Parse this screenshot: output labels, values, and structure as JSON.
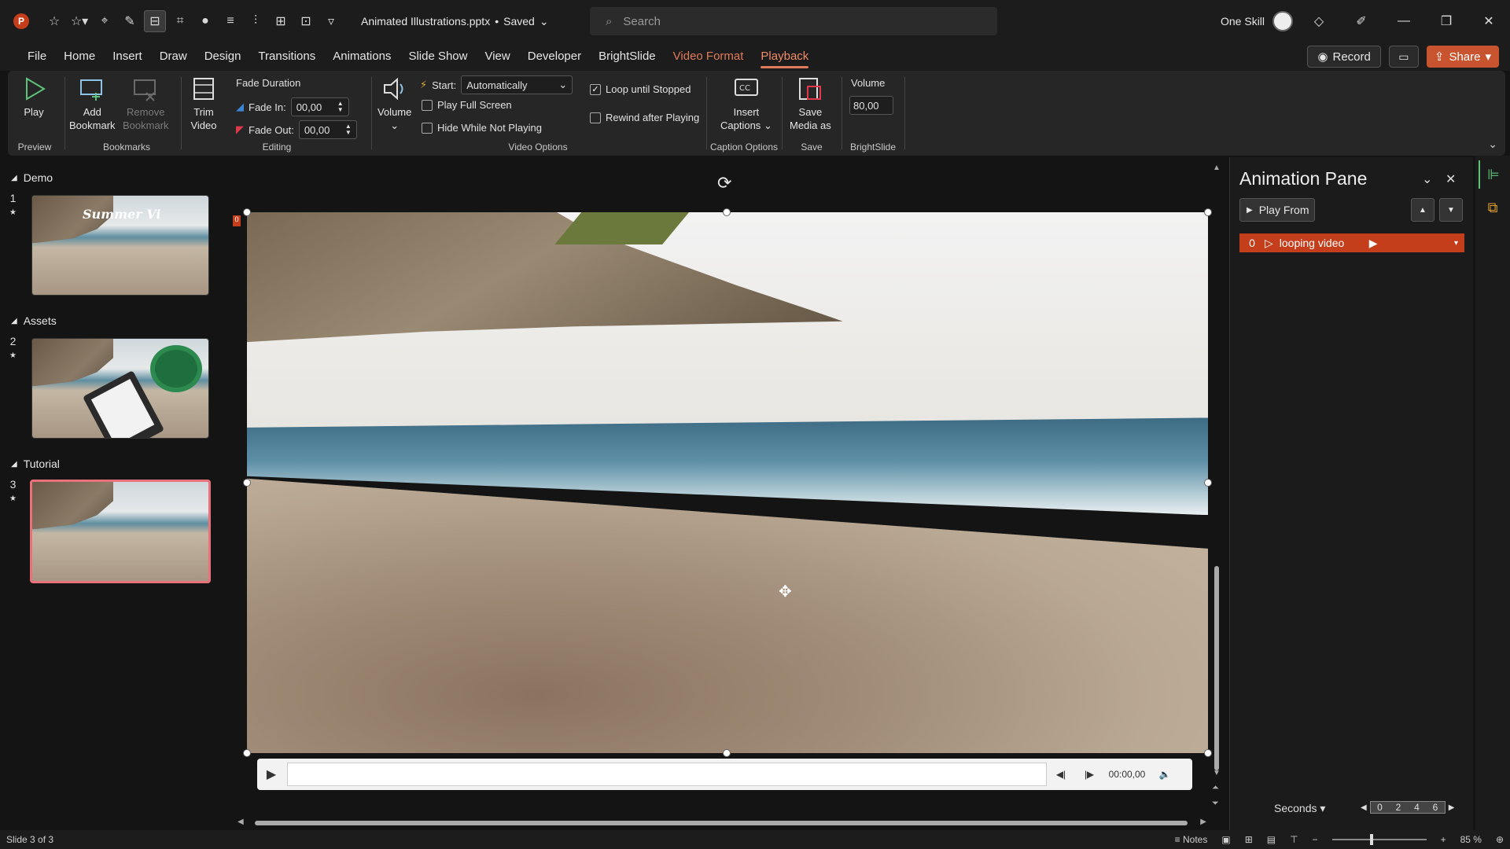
{
  "app": {
    "logo_letter": "P",
    "doc_title": "Animated Illustrations.pptx",
    "save_status": "Saved",
    "search_placeholder": "Search",
    "user_name": "One Skill"
  },
  "tabs": [
    "File",
    "Home",
    "Insert",
    "Draw",
    "Design",
    "Transitions",
    "Animations",
    "Slide Show",
    "View",
    "Developer",
    "BrightSlide",
    "Video Format",
    "Playback"
  ],
  "tab_actions": {
    "record": "Record",
    "share": "Share"
  },
  "ribbon": {
    "preview": {
      "play": "Play",
      "group": "Preview"
    },
    "bookmarks": {
      "add_line1": "Add",
      "add_line2": "Bookmark",
      "remove_line1": "Remove",
      "remove_line2": "Bookmark",
      "group": "Bookmarks"
    },
    "editing": {
      "trim_line1": "Trim",
      "trim_line2": "Video",
      "fade_duration": "Fade Duration",
      "fade_in_label": "Fade In:",
      "fade_in_value": "00,00",
      "fade_out_label": "Fade Out:",
      "fade_out_value": "00,00",
      "group": "Editing"
    },
    "video_options": {
      "volume": "Volume",
      "start_label": "Start:",
      "start_value": "Automatically",
      "play_full_screen": "Play Full Screen",
      "hide_while_not_playing": "Hide While Not Playing",
      "loop_until_stopped": "Loop until Stopped",
      "rewind_after_playing": "Rewind after Playing",
      "group": "Video Options"
    },
    "captions": {
      "insert_line1": "Insert",
      "insert_line2": "Captions",
      "group": "Caption Options"
    },
    "save": {
      "save_line1": "Save",
      "save_line2": "Media as",
      "group": "Save"
    },
    "brightslide": {
      "volume_label": "Volume",
      "volume_value": "80,00",
      "group": "BrightSlide"
    }
  },
  "slides": {
    "sections": [
      {
        "name": "Demo",
        "slides": [
          {
            "number": "1",
            "thumb_text": "Summer Vi"
          }
        ]
      },
      {
        "name": "Assets",
        "slides": [
          {
            "number": "2"
          }
        ]
      },
      {
        "name": "Tutorial",
        "slides": [
          {
            "number": "3"
          }
        ]
      }
    ],
    "selected": 3
  },
  "player": {
    "time": "00:00,00"
  },
  "animation_pane": {
    "title": "Animation Pane",
    "play_from": "Play From",
    "items": [
      {
        "index": "0",
        "label": "looping video"
      }
    ],
    "unit": "Seconds",
    "timeline_ticks": [
      "0",
      "2",
      "4",
      "6"
    ]
  },
  "status": {
    "slide_info": "Slide 3 of 3",
    "notes": "Notes",
    "zoom": "85 %"
  },
  "colors": {
    "accent": "#c43e1c",
    "contextual_tab": "#e07b5a",
    "selected_thumb_border": "#e8717b"
  }
}
